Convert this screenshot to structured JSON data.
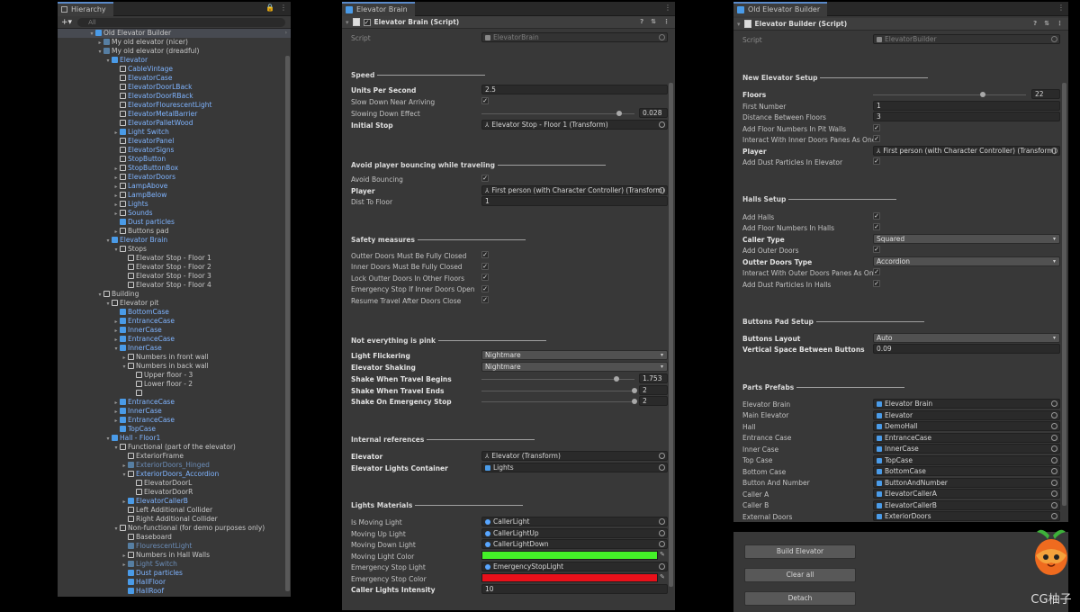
{
  "hierarchy": {
    "tab": "Hierarchy",
    "add_label": "+▾",
    "search_placeholder": "All",
    "rows": [
      {
        "label": "Old Elevator Builder",
        "depth": 0,
        "icon": "b",
        "arrow": "▾",
        "sel": true,
        "more": true
      },
      {
        "label": "My old elevator (nicer)",
        "depth": 1,
        "icon": "d",
        "arrow": "▸"
      },
      {
        "label": "My old elevator (dreadful)",
        "depth": 1,
        "icon": "d",
        "arrow": "▾"
      },
      {
        "label": "Elevator",
        "depth": 2,
        "icon": "b",
        "arrow": "▾",
        "blue": true
      },
      {
        "label": "CableVintage",
        "depth": 3,
        "icon": "w",
        "arrow": "",
        "blue": true
      },
      {
        "label": "ElevatorCase",
        "depth": 3,
        "icon": "w",
        "arrow": "",
        "blue": true
      },
      {
        "label": "ElevatorDoorLBack",
        "depth": 3,
        "icon": "w",
        "arrow": "",
        "blue": true
      },
      {
        "label": "ElevatorDoorRBack",
        "depth": 3,
        "icon": "w",
        "arrow": "",
        "blue": true
      },
      {
        "label": "ElevatorFlourescentLight",
        "depth": 3,
        "icon": "w",
        "arrow": "",
        "blue": true
      },
      {
        "label": "ElevatorMetalBarrier",
        "depth": 3,
        "icon": "w",
        "arrow": "",
        "blue": true
      },
      {
        "label": "ElevatorPalletWood",
        "depth": 3,
        "icon": "w",
        "arrow": "",
        "blue": true
      },
      {
        "label": "Light Switch",
        "depth": 3,
        "icon": "b",
        "arrow": "▸",
        "blue": true,
        "more": true
      },
      {
        "label": "ElevatorPanel",
        "depth": 3,
        "icon": "w",
        "arrow": "",
        "blue": true
      },
      {
        "label": "ElevatorSigns",
        "depth": 3,
        "icon": "w",
        "arrow": "",
        "blue": true
      },
      {
        "label": "StopButton",
        "depth": 3,
        "icon": "w",
        "arrow": "",
        "blue": true
      },
      {
        "label": "StopButtonBox",
        "depth": 3,
        "icon": "w",
        "arrow": "▸",
        "blue": true
      },
      {
        "label": "ElevatorDoors",
        "depth": 3,
        "icon": "w",
        "arrow": "▸",
        "blue": true
      },
      {
        "label": "LampAbove",
        "depth": 3,
        "icon": "w",
        "arrow": "▸",
        "blue": true
      },
      {
        "label": "LampBelow",
        "depth": 3,
        "icon": "w",
        "arrow": "▸",
        "blue": true
      },
      {
        "label": "Lights",
        "depth": 3,
        "icon": "w",
        "arrow": "▸",
        "blue": true
      },
      {
        "label": "Sounds",
        "depth": 3,
        "icon": "w",
        "arrow": "▸",
        "blue": true
      },
      {
        "label": "Dust particles",
        "depth": 3,
        "icon": "b",
        "arrow": "",
        "blue": true,
        "more": true
      },
      {
        "label": "Buttons pad",
        "depth": 3,
        "icon": "w",
        "arrow": "▸",
        "more": true
      },
      {
        "label": "Elevator Brain",
        "depth": 2,
        "icon": "b",
        "arrow": "▾",
        "blue": true
      },
      {
        "label": "Stops",
        "depth": 3,
        "icon": "w",
        "arrow": "▾"
      },
      {
        "label": "Elevator Stop - Floor 1",
        "depth": 4,
        "icon": "w",
        "arrow": ""
      },
      {
        "label": "Elevator Stop - Floor 2",
        "depth": 4,
        "icon": "w",
        "arrow": ""
      },
      {
        "label": "Elevator Stop - Floor 3",
        "depth": 4,
        "icon": "w",
        "arrow": ""
      },
      {
        "label": "Elevator Stop - Floor 4",
        "depth": 4,
        "icon": "w",
        "arrow": ""
      },
      {
        "label": "Building",
        "depth": 1,
        "icon": "w",
        "arrow": "▾"
      },
      {
        "label": "Elevator pit",
        "depth": 2,
        "icon": "w",
        "arrow": "▾"
      },
      {
        "label": "BottomCase",
        "depth": 3,
        "icon": "b",
        "arrow": "",
        "blue": true,
        "more": true
      },
      {
        "label": "EntranceCase",
        "depth": 3,
        "icon": "b",
        "arrow": "▸",
        "blue": true,
        "more": true
      },
      {
        "label": "InnerCase",
        "depth": 3,
        "icon": "b",
        "arrow": "▸",
        "blue": true,
        "more": true
      },
      {
        "label": "EntranceCase",
        "depth": 3,
        "icon": "b",
        "arrow": "▸",
        "blue": true,
        "more": true
      },
      {
        "label": "InnerCase",
        "depth": 3,
        "icon": "b",
        "arrow": "▾",
        "blue": true,
        "more": true
      },
      {
        "label": "Numbers in front wall",
        "depth": 4,
        "icon": "w",
        "arrow": "▸"
      },
      {
        "label": "Numbers in back wall",
        "depth": 4,
        "icon": "w",
        "arrow": "▾"
      },
      {
        "label": "Upper floor - 3",
        "depth": 5,
        "icon": "w",
        "arrow": ""
      },
      {
        "label": "Lower floor - 2",
        "depth": 5,
        "icon": "w",
        "arrow": ""
      },
      {
        "label": "",
        "depth": 5,
        "icon": "w",
        "arrow": ""
      },
      {
        "label": "EntranceCase",
        "depth": 3,
        "icon": "b",
        "arrow": "▸",
        "blue": true,
        "more": true
      },
      {
        "label": "InnerCase",
        "depth": 3,
        "icon": "b",
        "arrow": "▸",
        "blue": true,
        "more": true
      },
      {
        "label": "EntranceCase",
        "depth": 3,
        "icon": "b",
        "arrow": "▸",
        "blue": true,
        "more": true
      },
      {
        "label": "TopCase",
        "depth": 3,
        "icon": "b",
        "arrow": "",
        "blue": true,
        "more": true
      },
      {
        "label": "Hall - Floor1",
        "depth": 2,
        "icon": "b",
        "arrow": "▾",
        "blue": true,
        "more": true
      },
      {
        "label": "Functional (part of the elevator)",
        "depth": 3,
        "icon": "w",
        "arrow": "▾"
      },
      {
        "label": "ExteriorFrame",
        "depth": 4,
        "icon": "w",
        "arrow": ""
      },
      {
        "label": "ExteriorDoors_Hinged",
        "depth": 4,
        "icon": "d",
        "arrow": "▸",
        "faded": true,
        "more": true
      },
      {
        "label": "ExteriorDoors_Accordion",
        "depth": 4,
        "icon": "w",
        "arrow": "▾",
        "blue": true
      },
      {
        "label": "ElevatorDoorL",
        "depth": 5,
        "icon": "w",
        "arrow": ""
      },
      {
        "label": "ElevatorDoorR",
        "depth": 5,
        "icon": "w",
        "arrow": ""
      },
      {
        "label": "ElevatorCallerB",
        "depth": 4,
        "icon": "b",
        "arrow": "▸",
        "blue": true,
        "more": true
      },
      {
        "label": "Left Additional Collider",
        "depth": 4,
        "icon": "w",
        "arrow": ""
      },
      {
        "label": "Right Additional Collider",
        "depth": 4,
        "icon": "w",
        "arrow": ""
      },
      {
        "label": "Non-functional (for demo purposes only)",
        "depth": 3,
        "icon": "w",
        "arrow": "▾"
      },
      {
        "label": "Baseboard",
        "depth": 4,
        "icon": "w",
        "arrow": ""
      },
      {
        "label": "FlourescentLight",
        "depth": 4,
        "icon": "d",
        "arrow": "",
        "faded": true
      },
      {
        "label": "Numbers in Hall Walls",
        "depth": 4,
        "icon": "w",
        "arrow": "▸",
        "more": true
      },
      {
        "label": "Light Switch",
        "depth": 4,
        "icon": "d",
        "arrow": "▸",
        "faded": true,
        "more": true
      },
      {
        "label": "Dust particles",
        "depth": 4,
        "icon": "b",
        "arrow": "",
        "blue": true,
        "more": true
      },
      {
        "label": "HallFloor",
        "depth": 4,
        "icon": "b",
        "arrow": "",
        "blue": true
      },
      {
        "label": "HallRoof",
        "depth": 4,
        "icon": "b",
        "arrow": "",
        "blue": true
      }
    ]
  },
  "brain": {
    "tab": "Elevator Brain",
    "component": "Elevator Brain (Script)",
    "script_label": "Script",
    "script_value": "ElevatorBrain",
    "speed_header": "Speed",
    "units_per_second_label": "Units Per Second",
    "units_per_second": "2.5",
    "slow_down_label": "Slow Down Near Arriving",
    "slowing_effect_label": "Slowing Down Effect",
    "slowing_effect": "0.028",
    "slowing_effect_level": 0.9,
    "initial_stop_label": "Initial Stop",
    "initial_stop": "Elevator Stop - Floor 1 (Transform)",
    "avoid_header": "Avoid player bouncing while traveling",
    "avoid_bouncing_label": "Avoid Bouncing",
    "player_label": "Player",
    "player": "First person (with Character Controller) (Transform)",
    "dist_floor_label": "Dist To Floor",
    "dist_floor": "1",
    "safety_header": "Safety measures",
    "safety_items": [
      "Outter Doors Must Be Fully Closed",
      "Inner Doors Must Be Fully Closed",
      "Lock Outter Doors In Other Floors",
      "Emergency Stop If Inner Doors Open",
      "Resume Travel After Doors Close"
    ],
    "pink_header": "Not everything is pink",
    "flicker_label": "Light Flickering",
    "flicker": "Nightmare",
    "shaking_label": "Elevator Shaking",
    "shaking": "Nightmare",
    "shake_begins_label": "Shake When Travel Begins",
    "shake_begins": "1.753",
    "shake_begins_level": 0.88,
    "shake_ends_label": "Shake When Travel Ends",
    "shake_ends": "2",
    "shake_ends_level": 1.0,
    "shake_emergency_label": "Shake On Emergency Stop",
    "shake_emergency": "2",
    "shake_emergency_level": 1.0,
    "internal_header": "Internal references",
    "elevator_label": "Elevator",
    "elevator": "Elevator (Transform)",
    "lights_container_label": "Elevator Lights Container",
    "lights_container": "Lights",
    "materials_header": "Lights Materials",
    "is_moving_label": "Is Moving Light",
    "is_moving": "CallerLight",
    "moving_up_label": "Moving Up Light",
    "moving_up": "CallerLightUp",
    "moving_down_label": "Moving Down Light",
    "moving_down": "CallerLightDown",
    "moving_color_label": "Moving Light Color",
    "moving_color": "#44f128",
    "emergency_light_label": "Emergency Stop Light",
    "emergency_light": "EmergencyStopLight",
    "emergency_color_label": "Emergency Stop Color",
    "emergency_color": "#e8101a",
    "intensity_label": "Caller Lights Intensity",
    "intensity": "10"
  },
  "builder": {
    "tab": "Old Elevator Builder",
    "component": "Elevator Builder (Script)",
    "script_label": "Script",
    "script_value": "ElevatorBuilder",
    "new_header": "New Elevator Setup",
    "floors_label": "Floors",
    "floors": "22",
    "floors_level": 0.72,
    "first_number_label": "First Number",
    "first_number": "1",
    "distance_label": "Distance Between Floors",
    "distance": "3",
    "pit_walls_label": "Add Floor Numbers In Pit Walls",
    "inner_panes_label": "Interact With Inner Doors Panes As One",
    "player_label": "Player",
    "player": "First person (with Character Controller) (Transform)",
    "dust_label": "Add Dust Particles In Elevator",
    "halls_header": "Halls Setup",
    "add_halls_label": "Add Halls",
    "halls_numbers_label": "Add Floor Numbers In Halls",
    "caller_type_label": "Caller Type",
    "caller_type": "Squared",
    "outer_doors_label": "Add Outer Doors",
    "outter_type_label": "Outter Doors Type",
    "outter_type": "Accordion",
    "outer_panes_label": "Interact With Outer Doors Panes As One",
    "halls_dust_label": "Add Dust Particles In Halls",
    "pad_header": "Buttons Pad Setup",
    "layout_label": "Buttons Layout",
    "layout": "Auto",
    "vspace_label": "Vertical Space Between Buttons",
    "vspace": "0.09",
    "prefabs_header": "Parts Prefabs",
    "prefabs": [
      {
        "label": "Elevator Brain",
        "value": "Elevator Brain"
      },
      {
        "label": "Main Elevator",
        "value": "Elevator"
      },
      {
        "label": "Hall",
        "value": "DemoHall"
      },
      {
        "label": "Entrance Case",
        "value": "EntranceCase"
      },
      {
        "label": "Inner Case",
        "value": "InnerCase"
      },
      {
        "label": "Top Case",
        "value": "TopCase"
      },
      {
        "label": "Bottom Case",
        "value": "BottomCase"
      },
      {
        "label": "Button And Number",
        "value": "ButtonAndNumber"
      },
      {
        "label": "Caller A",
        "value": "ElevatorCallerA"
      },
      {
        "label": "Caller B",
        "value": "ElevatorCallerB"
      },
      {
        "label": "External Doors",
        "value": "ExteriorDoors"
      }
    ],
    "build_button": "Build Elevator",
    "clear_button": "Clear all",
    "detach_button": "Detach"
  },
  "watermark": "CG柚子"
}
